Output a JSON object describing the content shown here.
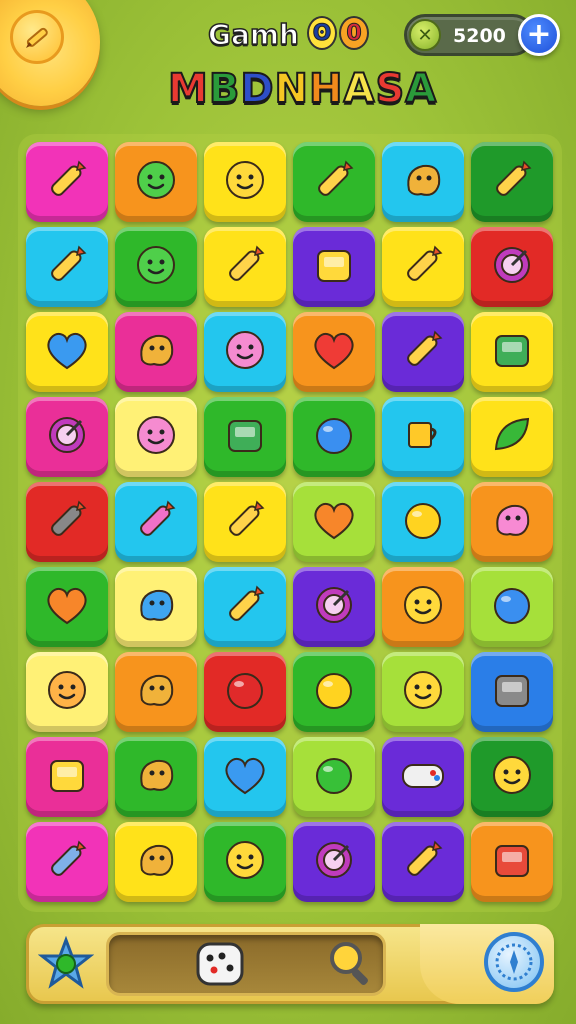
{
  "header": {
    "title_line1": "Gamh",
    "title_badges": [
      "ʘ",
      "0"
    ],
    "title_line2": [
      "M",
      "B",
      "D",
      "N",
      "H",
      "A",
      "S",
      "A"
    ],
    "currency_amount": "5200",
    "currency_icon": "x-coin-icon",
    "add_button_label": "+"
  },
  "colors": {
    "pink": "#f233b8",
    "orange": "#f7941d",
    "yellow": "#ffe21a",
    "green": "#2fb82a",
    "cyan": "#23c6ee",
    "purple": "#6a2bd8",
    "red": "#e22a26",
    "lime": "#a6e03a",
    "lightyellow": "#fff176",
    "magenta": "#ea2f98",
    "darkgreen": "#1f9a2a",
    "blue": "#2a7ee8"
  },
  "board": {
    "rows": [
      [
        {
          "color": "pink",
          "icon": "eraser-icon"
        },
        {
          "color": "orange",
          "icon": "green-blob-face-icon"
        },
        {
          "color": "yellow",
          "icon": "smiley-face-icon"
        },
        {
          "color": "green",
          "icon": "crayon-icon"
        },
        {
          "color": "cyan",
          "icon": "hammer-icon"
        },
        {
          "color": "darkgreen",
          "icon": "ice-cream-cone-icon"
        }
      ],
      [
        {
          "color": "cyan",
          "icon": "rocket-icon"
        },
        {
          "color": "green",
          "icon": "green-robot-face-icon"
        },
        {
          "color": "yellow",
          "icon": "pencil-case-icon"
        },
        {
          "color": "purple",
          "icon": "backpack-icon"
        },
        {
          "color": "yellow",
          "icon": "paint-dropper-icon"
        },
        {
          "color": "red",
          "icon": "target-icon"
        }
      ],
      [
        {
          "color": "yellow",
          "icon": "blue-heart-icon"
        },
        {
          "color": "magenta",
          "icon": "lamp-icon"
        },
        {
          "color": "cyan",
          "icon": "cat-face-icon"
        },
        {
          "color": "orange",
          "icon": "red-heart-icon"
        },
        {
          "color": "purple",
          "icon": "glue-stick-icon"
        },
        {
          "color": "yellow",
          "icon": "camera-icon"
        }
      ],
      [
        {
          "color": "magenta",
          "icon": "compass-rose-icon"
        },
        {
          "color": "lightyellow",
          "icon": "pink-block-face-icon"
        },
        {
          "color": "green",
          "icon": "calculator-icon"
        },
        {
          "color": "green",
          "icon": "globe-icon"
        },
        {
          "color": "cyan",
          "icon": "mug-icon"
        },
        {
          "color": "yellow",
          "icon": "leaf-icon"
        }
      ],
      [
        {
          "color": "red",
          "icon": "marker-icon"
        },
        {
          "color": "cyan",
          "icon": "pink-eraser-icon"
        },
        {
          "color": "yellow",
          "icon": "pencil-sharpener-icon"
        },
        {
          "color": "lime",
          "icon": "orange-heart-icon"
        },
        {
          "color": "cyan",
          "icon": "apple-icon"
        },
        {
          "color": "orange",
          "icon": "pink-blob-icon"
        }
      ],
      [
        {
          "color": "green",
          "icon": "orange-heart-icon"
        },
        {
          "color": "lightyellow",
          "icon": "blue-splash-icon"
        },
        {
          "color": "cyan",
          "icon": "pencil-icon"
        },
        {
          "color": "purple",
          "icon": "pink-ring-icon"
        },
        {
          "color": "orange",
          "icon": "smiley-bubble-icon"
        },
        {
          "color": "lime",
          "icon": "blue-ball-icon"
        }
      ],
      [
        {
          "color": "lightyellow",
          "icon": "orange-face-icon"
        },
        {
          "color": "orange",
          "icon": "bunny-icon"
        },
        {
          "color": "red",
          "icon": "red-ball-icon"
        },
        {
          "color": "green",
          "icon": "yellow-ball-icon"
        },
        {
          "color": "lime",
          "icon": "robot-box-face-icon"
        },
        {
          "color": "blue",
          "icon": "speaker-icon"
        }
      ],
      [
        {
          "color": "magenta",
          "icon": "yellow-bag-icon"
        },
        {
          "color": "green",
          "icon": "molecule-icon"
        },
        {
          "color": "cyan",
          "icon": "blue-heart-icon"
        },
        {
          "color": "lime",
          "icon": "green-ball-icon"
        },
        {
          "color": "purple",
          "icon": "gamepad-icon"
        },
        {
          "color": "darkgreen",
          "icon": "yellow-smiley-icon"
        }
      ],
      [
        {
          "color": "pink",
          "icon": "blue-crayon-icon"
        },
        {
          "color": "yellow",
          "icon": "wrench-icon"
        },
        {
          "color": "green",
          "icon": "yellow-blob-face-icon"
        },
        {
          "color": "purple",
          "icon": "purple-target-icon"
        },
        {
          "color": "purple",
          "icon": "brush-icon"
        },
        {
          "color": "orange",
          "icon": "lunchbox-icon"
        }
      ]
    ]
  },
  "bottom_bar": {
    "left_icon": "star-shield-icon",
    "center_icons": [
      "dice-icon",
      "magnifier-icon"
    ],
    "right_icon": "compass-button-icon"
  }
}
